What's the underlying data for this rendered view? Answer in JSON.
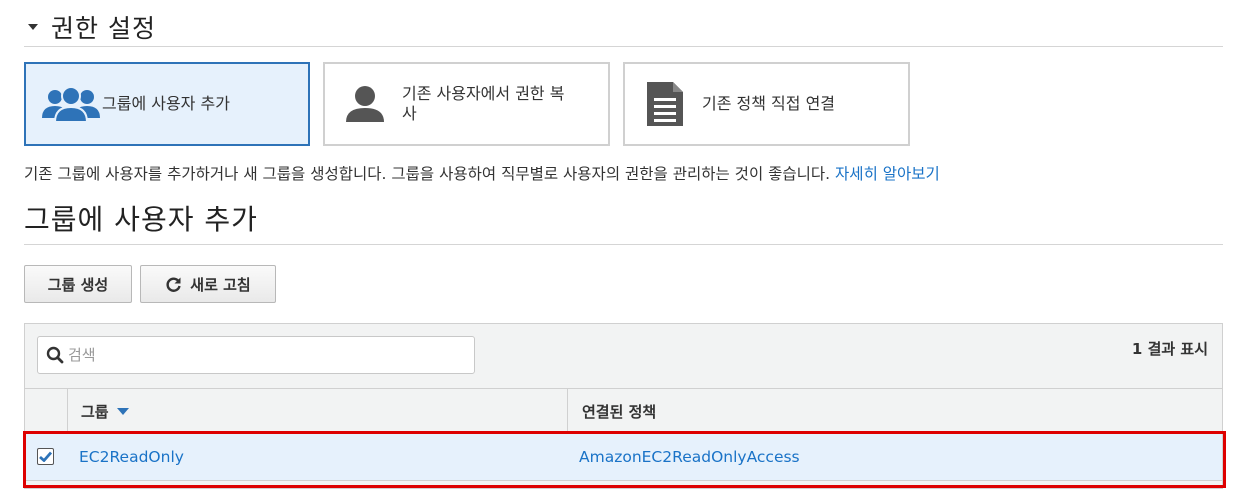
{
  "permissions": {
    "title": "권한 설정",
    "options": [
      {
        "label": "그룹에 사용자 추가",
        "icon": "users-group-icon",
        "selected": true
      },
      {
        "label_line1": "기존 사용자에서 권한 복",
        "label_line2": "사",
        "icon": "user-icon",
        "selected": false
      },
      {
        "label": "기존 정책 직접 연결",
        "icon": "document-icon",
        "selected": false
      }
    ],
    "description": "기존 그룹에 사용자를 추가하거나 새 그룹을 생성합니다. 그룹을 사용하여 직무별로 사용자의 권한을 관리하는 것이 좋습니다.",
    "learn_more": "자세히 알아보기"
  },
  "add_to_group": {
    "title": "그룹에 사용자 추가",
    "create_group_label": "그룹 생성",
    "refresh_label": "새로 고침"
  },
  "table": {
    "search": {
      "placeholder": "검색",
      "value": ""
    },
    "result_count": "1 결과 표시",
    "columns": [
      "그룹",
      "연결된 정책"
    ],
    "sort_column": "그룹",
    "rows": [
      {
        "checked": true,
        "group": "EC2ReadOnly",
        "policy": "AmazonEC2ReadOnlyAccess"
      }
    ]
  },
  "colors": {
    "accent": "#2e73b8",
    "link": "#1a73c7",
    "selected_bg": "#e6f1fc",
    "highlight": "#dd0000"
  }
}
